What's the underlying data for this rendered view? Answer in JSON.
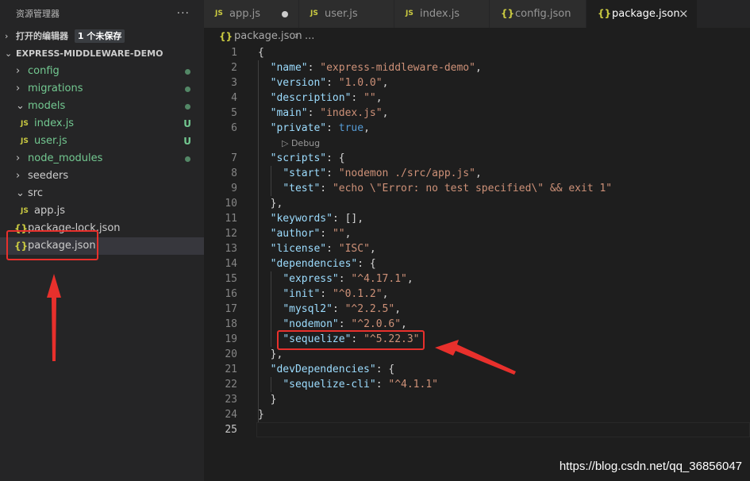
{
  "sidebar": {
    "title": "资源管理器",
    "more_label": "···",
    "open_editors": {
      "label": "打开的编辑器",
      "badge": "1 个未保存"
    },
    "project": {
      "label": "EXPRESS-MIDDLEWARE-DEMO"
    },
    "tree": [
      {
        "label": "config",
        "type": "folder",
        "expanded": false,
        "status": "dot"
      },
      {
        "label": "migrations",
        "type": "folder",
        "expanded": false,
        "status": "dot"
      },
      {
        "label": "models",
        "type": "folder",
        "expanded": true,
        "status": "dot"
      },
      {
        "label": "index.js",
        "type": "js",
        "status": "U"
      },
      {
        "label": "user.js",
        "type": "js",
        "status": "U"
      },
      {
        "label": "node_modules",
        "type": "folder",
        "expanded": false,
        "status": "dot"
      },
      {
        "label": "seeders",
        "type": "folder",
        "expanded": false,
        "status": ""
      },
      {
        "label": "src",
        "type": "folder",
        "expanded": true,
        "status": ""
      },
      {
        "label": "app.js",
        "type": "js",
        "status": ""
      },
      {
        "label": "package-lock.json",
        "type": "json",
        "status": ""
      },
      {
        "label": "package.json",
        "type": "json",
        "status": "",
        "selected": true
      }
    ]
  },
  "icons": {
    "js": "JS",
    "json": "{}",
    "chevron_right": "›",
    "chevron_down": "⌄",
    "close": "×"
  },
  "tabs": [
    {
      "label": "app.js",
      "type": "js",
      "modified": true,
      "active": false
    },
    {
      "label": "user.js",
      "type": "js",
      "modified": false,
      "active": false
    },
    {
      "label": "index.js",
      "type": "js",
      "modified": false,
      "active": false
    },
    {
      "label": "config.json",
      "type": "json",
      "modified": false,
      "active": false
    },
    {
      "label": "package.json",
      "type": "json",
      "modified": false,
      "active": true
    }
  ],
  "breadcrumb": {
    "file": "package.json",
    "separator": "›",
    "more": "..."
  },
  "codelens": "▷ Debug",
  "code_lines": [
    {
      "n": "1",
      "text": "{"
    },
    {
      "n": "2",
      "text": "  \"name\": \"express-middleware-demo\","
    },
    {
      "n": "3",
      "text": "  \"version\": \"1.0.0\","
    },
    {
      "n": "4",
      "text": "  \"description\": \"\","
    },
    {
      "n": "5",
      "text": "  \"main\": \"index.js\","
    },
    {
      "n": "6",
      "text": "  \"private\": true,"
    },
    {
      "n": "7",
      "text": "  \"scripts\": {"
    },
    {
      "n": "8",
      "text": "    \"start\": \"nodemon ./src/app.js\","
    },
    {
      "n": "9",
      "text": "    \"test\": \"echo \\\"Error: no test specified\\\" && exit 1\""
    },
    {
      "n": "10",
      "text": "  },"
    },
    {
      "n": "11",
      "text": "  \"keywords\": [],"
    },
    {
      "n": "12",
      "text": "  \"author\": \"\","
    },
    {
      "n": "13",
      "text": "  \"license\": \"ISC\","
    },
    {
      "n": "14",
      "text": "  \"dependencies\": {"
    },
    {
      "n": "15",
      "text": "    \"express\": \"^4.17.1\","
    },
    {
      "n": "16",
      "text": "    \"init\": \"^0.1.2\","
    },
    {
      "n": "17",
      "text": "    \"mysql2\": \"^2.2.5\","
    },
    {
      "n": "18",
      "text": "    \"nodemon\": \"^2.0.6\","
    },
    {
      "n": "19",
      "text": "    \"sequelize\": \"^5.22.3\""
    },
    {
      "n": "20",
      "text": "  },"
    },
    {
      "n": "21",
      "text": "  \"devDependencies\": {"
    },
    {
      "n": "22",
      "text": "    \"sequelize-cli\": \"^4.1.1\""
    },
    {
      "n": "23",
      "text": "  }"
    },
    {
      "n": "24",
      "text": "}"
    },
    {
      "n": "25",
      "text": ""
    }
  ],
  "current_line": "25",
  "watermark": "https://blog.csdn.net/qq_36856047",
  "colors": {
    "key": "#9cdcfe",
    "string": "#ce9178",
    "boolean": "#569cd6",
    "punct": "#d4d4d4",
    "annotation": "#e8302c",
    "git_green": "#73c991",
    "json_icon": "#cbcb41"
  }
}
